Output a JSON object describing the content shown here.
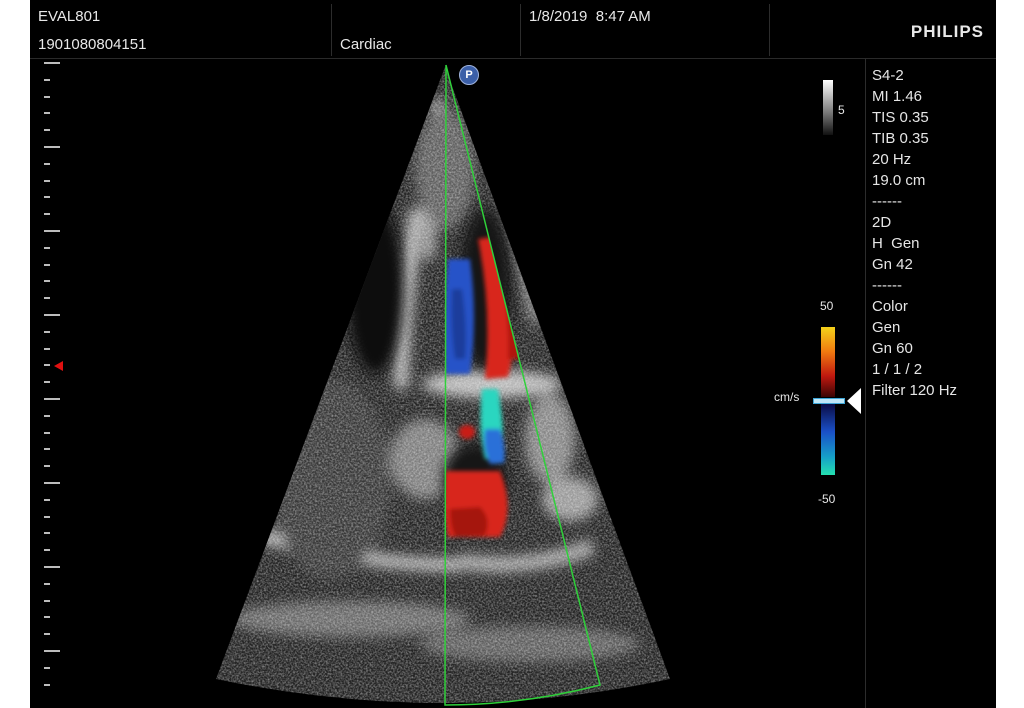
{
  "header": {
    "patient_name": "EVAL801",
    "patient_id": "1901080804151",
    "exam_type": "Cardiac",
    "datetime": "1/8/2019  8:47 AM",
    "brand": "PHILIPS"
  },
  "image": {
    "probe_badge": "P",
    "grayscale_bar_label": "5",
    "color_scale": {
      "max": "50",
      "min": "-50",
      "unit": "cm/s"
    }
  },
  "parameters": [
    "S4-2",
    "MI 1.46",
    "TIS 0.35",
    "TIB 0.35",
    "20 Hz",
    "19.0 cm",
    "------",
    "2D",
    "H  Gen",
    "Gn 42",
    "------",
    "Color",
    "Gen",
    "Gn 60",
    "1 / 1 / 2",
    "Filter 120 Hz"
  ],
  "colors": {
    "background": "#000000",
    "color_box_outline": "#2fd03a",
    "flow_red": "#d8261a",
    "flow_blue": "#2553c8",
    "flow_cyan": "#2ad6c0",
    "focus_marker": "#e01010"
  }
}
